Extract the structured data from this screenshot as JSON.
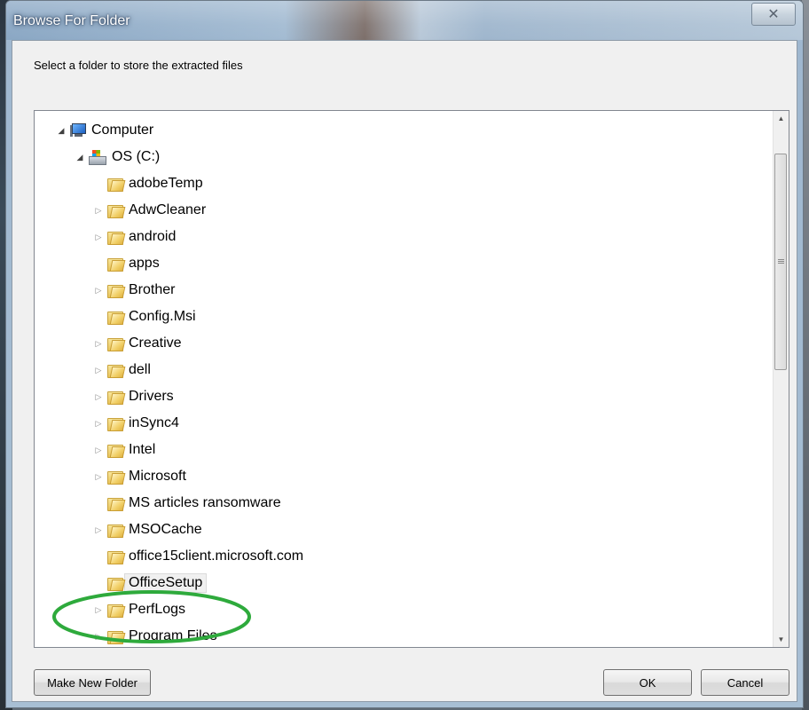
{
  "window": {
    "title": "Browse For Folder",
    "close_glyph": "✕"
  },
  "instruction": "Select a folder to store the extracted files",
  "tree": {
    "computer": {
      "label": "Computer",
      "icon": "computer-icon",
      "expanded": true
    },
    "drive": {
      "label": "OS (C:)",
      "icon": "drive-icon",
      "expanded": true
    },
    "folders": [
      {
        "label": "adobeTemp",
        "has_children": false
      },
      {
        "label": "AdwCleaner",
        "has_children": true
      },
      {
        "label": "android",
        "has_children": true
      },
      {
        "label": "apps",
        "has_children": false
      },
      {
        "label": "Brother",
        "has_children": true
      },
      {
        "label": "Config.Msi",
        "has_children": false
      },
      {
        "label": "Creative",
        "has_children": true
      },
      {
        "label": "dell",
        "has_children": true
      },
      {
        "label": "Drivers",
        "has_children": true
      },
      {
        "label": "inSync4",
        "has_children": true
      },
      {
        "label": "Intel",
        "has_children": true
      },
      {
        "label": "Microsoft",
        "has_children": true
      },
      {
        "label": "MS articles ransomware",
        "has_children": false
      },
      {
        "label": "MSOCache",
        "has_children": true
      },
      {
        "label": "office15client.microsoft.com",
        "has_children": false
      },
      {
        "label": "OfficeSetup",
        "has_children": false,
        "selected": true
      },
      {
        "label": "PerfLogs",
        "has_children": true
      },
      {
        "label": "Program Files",
        "has_children": true
      }
    ]
  },
  "buttons": {
    "make_new_folder": "Make New Folder",
    "ok": "OK",
    "cancel": "Cancel"
  },
  "colors": {
    "highlight_ellipse": "#2eaa3c",
    "title_text": "#ffffff"
  }
}
